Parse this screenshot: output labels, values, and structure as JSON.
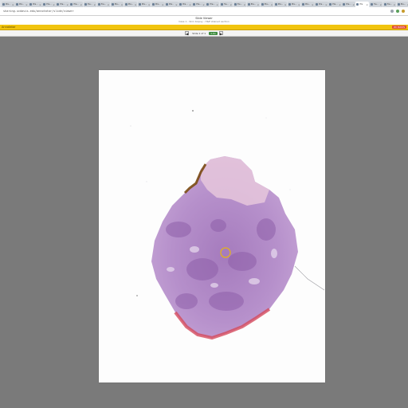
{
  "browser": {
    "tabs": [
      {
        "label": "Pre..."
      },
      {
        "label": "Pre..."
      },
      {
        "label": "Pre..."
      },
      {
        "label": "Pre..."
      },
      {
        "label": "Pre..."
      },
      {
        "label": "Pre..."
      },
      {
        "label": "Pre..."
      },
      {
        "label": "Pre..."
      },
      {
        "label": "Pre..."
      },
      {
        "label": "Pre..."
      },
      {
        "label": "Pre..."
      },
      {
        "label": "Pre..."
      },
      {
        "label": "Pre..."
      },
      {
        "label": "Pre..."
      },
      {
        "label": "Pre..."
      },
      {
        "label": "Pre..."
      },
      {
        "label": "Pre..."
      },
      {
        "label": "Pre..."
      },
      {
        "label": "Pre..."
      },
      {
        "label": "Pre..."
      },
      {
        "label": "Pre..."
      },
      {
        "label": "Pre..."
      },
      {
        "label": "Pre..."
      },
      {
        "label": "Pre..."
      },
      {
        "label": "Pre..."
      },
      {
        "label": "Pre..."
      },
      {
        "label": "Pre"
      },
      {
        "label": "Pre..."
      },
      {
        "label": "Pre..."
      },
      {
        "label": "Pre..."
      }
    ],
    "url": "sharing.ucdavis.edu/annotator/slide/viewer"
  },
  "header": {
    "title": "Slide Viewer",
    "subtitle": "Case 1 - Skin biopsy - H&E stained section"
  },
  "toolbar": {
    "brand": "Annotator",
    "badge": "UC DAVIS"
  },
  "subbar": {
    "prev": "◀",
    "next": "▶",
    "info": "Slide 1 of 1",
    "zoom_label": "1.0x"
  },
  "colors": {
    "toolbar": "#f1c40f",
    "viewer_bg": "#7a7a7a",
    "tissue_base": "#b98fc9",
    "tissue_dark": "#8b5aa6",
    "tissue_pink": "#e8b8c9",
    "edge_red": "#d44a5d",
    "annotation": "#e3b21c"
  },
  "icons": {
    "prev": "chevron-left-icon",
    "next": "chevron-right-icon"
  }
}
